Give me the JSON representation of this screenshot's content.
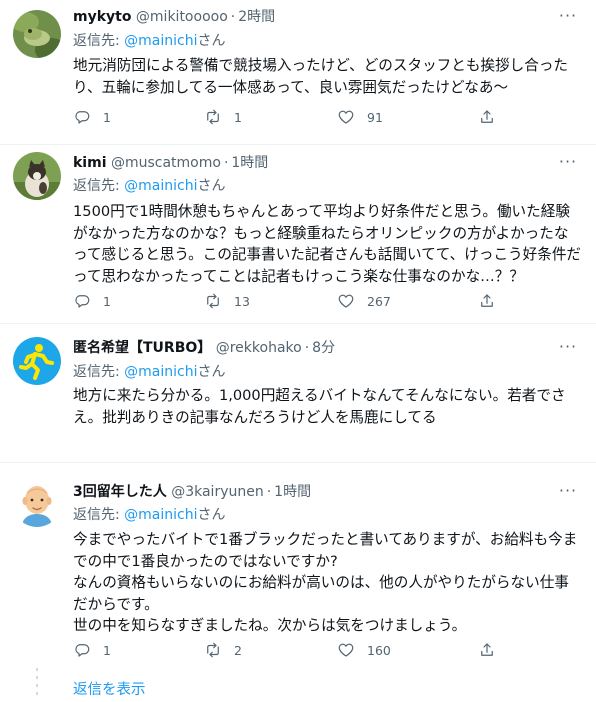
{
  "tweets": [
    {
      "name": "mykyto",
      "handle": "@mikitooooo",
      "time": "2時間",
      "reply_prefix": "返信先:",
      "reply_user": "@mainichi",
      "reply_suffix": "さん",
      "text": "地元消防団による警備で競技場入ったけど、どのスタッフとも挨拶し合ったり、五輪に参加してる一体感あって、良い雰囲気だったけどなあ〜",
      "replies": "1",
      "retweets": "1",
      "likes": "91",
      "avatar": "frog-on-leaf"
    },
    {
      "name": "kimi",
      "handle": "@muscatmomo",
      "time": "1時間",
      "reply_prefix": "返信先:",
      "reply_user": "@mainichi",
      "reply_suffix": "さん",
      "text": "1500円で1時間休憩もちゃんとあって平均より好条件だと思う。働いた経験がなかった方なのかな？もっと経験重ねたらオリンピックの方がよかったなって感じると思う。この記事書いた記者さんも話聞いてて、けっこう好条件だって思わなかったってことは記者もけっこう楽な仕事なのかな…？？",
      "replies": "1",
      "retweets": "13",
      "likes": "267",
      "avatar": "cat-photo"
    },
    {
      "name": "匿名希望【TURBO】",
      "handle": "@rekkohako",
      "time": "8分",
      "reply_prefix": "返信先:",
      "reply_user": "@mainichi",
      "reply_suffix": "さん",
      "text": "地方に来たら分かる。1,000円超えるバイトなんてそんなにない。若者でさえ。批判ありきの記事なんだろうけど人を馬鹿にしてる",
      "replies": "",
      "retweets": "",
      "likes": "",
      "avatar": "running-man-sign"
    },
    {
      "name": "3回留年した人",
      "handle": "@3kairyunen",
      "time": "1時間",
      "reply_prefix": "返信先:",
      "reply_user": "@mainichi",
      "reply_suffix": "さん",
      "text": "今までやったバイトで1番ブラックだったと書いてありますが、お給料も今までの中で1番良かったのではないですか?\nなんの資格もいらないのにお給料が高いのは、他の人がやりたがらない仕事だからです。\n世の中を知らなすぎましたね。次からは気をつけましょう。",
      "replies": "1",
      "retweets": "2",
      "likes": "160",
      "avatar": "bald-man-illustration"
    }
  ],
  "show_replies_label": "返信を表示",
  "icons": {
    "reply": "reply-icon",
    "retweet": "retweet-icon",
    "like": "heart-icon",
    "share": "share-icon",
    "more": "more-icon"
  },
  "colors": {
    "link": "#1d9bf0",
    "secondary_text": "#536471",
    "divider": "#eff3f4"
  }
}
